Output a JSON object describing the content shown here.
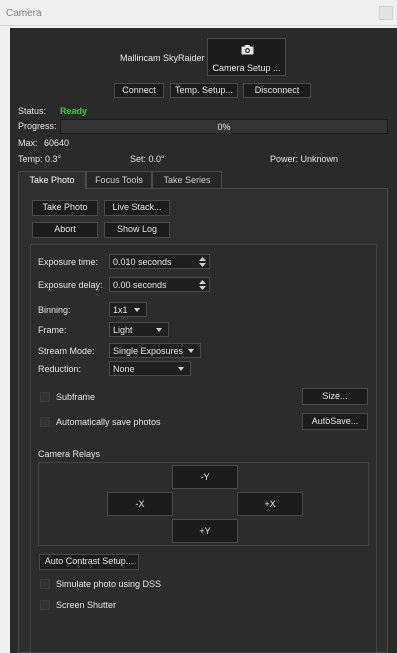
{
  "window": {
    "title": "Camera"
  },
  "device": {
    "name": "Mallincam SkyRaider",
    "setup_label": "Camera Setup ...",
    "icon": "camera-icon"
  },
  "connection": {
    "connect": "Connect",
    "temp_setup": "Temp. Setup...",
    "disconnect": "Disconnect"
  },
  "status": {
    "status_label": "Status:",
    "status_value": "Ready",
    "status_color": "#2fd12f",
    "progress_label": "Progress:",
    "progress_value": "0%",
    "progress_fraction": 0,
    "max_label": "Max:",
    "max_value": "60640",
    "temp_text": "Temp: 0.3°",
    "set_text": "Set: 0.0°",
    "power_text": "Power: Unknown"
  },
  "tabs": [
    {
      "label": "Take Photo"
    },
    {
      "label": "Focus Tools"
    },
    {
      "label": "Take Series"
    }
  ],
  "actions": {
    "take_photo": "Take Photo",
    "live_stack": "Live Stack...",
    "abort": "Abort",
    "show_log": "Show Log"
  },
  "settings": {
    "exposure_time": {
      "label": "Exposure time:",
      "value": "0.010 seconds"
    },
    "exposure_delay": {
      "label": "Exposure delay:",
      "value": "0.00 seconds"
    },
    "binning": {
      "label": "Binning:",
      "value": "1x1"
    },
    "frame": {
      "label": "Frame:",
      "value": "Light"
    },
    "stream_mode": {
      "label": "Stream Mode:",
      "value": "Single Exposures"
    },
    "reduction": {
      "label": "Reduction:",
      "value": "None"
    }
  },
  "options": {
    "subframe": "Subframe",
    "size_button": "Size...",
    "auto_save": "Automatically save photos",
    "autosave_button": "AutoSave..."
  },
  "relays": {
    "title": "Camera Relays",
    "minus_y": "-Y",
    "minus_x": "-X",
    "plus_x": "+X",
    "plus_y": "+Y"
  },
  "bottom": {
    "auto_contrast": "Auto Contrast Setup...",
    "simulate": "Simulate photo using DSS",
    "shutter": "Screen Shutter"
  }
}
